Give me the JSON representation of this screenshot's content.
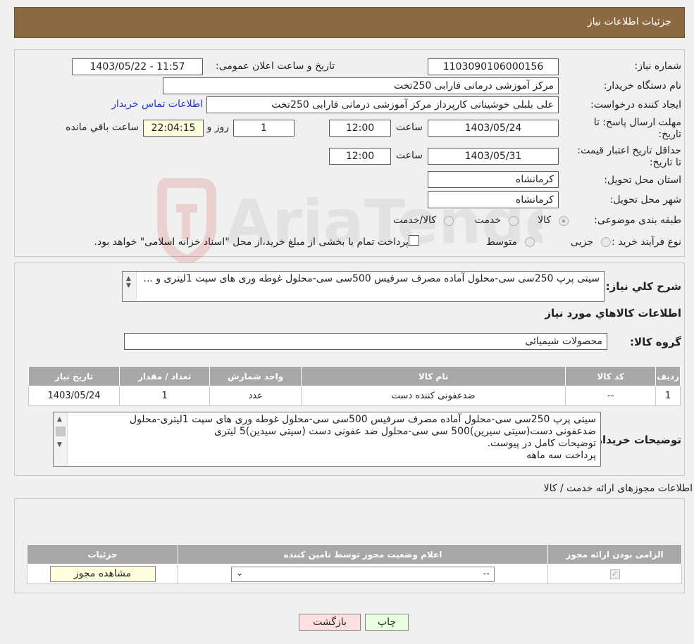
{
  "header": {
    "title": "جزئیات اطلاعات نیاز"
  },
  "form": {
    "need_number_label": "شماره نیاز:",
    "need_number": "1103090106000156",
    "announce_label": "تاریخ و ساعت اعلان عمومی:",
    "announce_value": "1403/05/22 - 11:57",
    "buyer_org_label": "نام دستگاه خریدار:",
    "buyer_org": "مرکز آموزشی  درمانی فارابی 250تخت",
    "requester_label": "ایجاد کننده درخواست:",
    "requester": "علی بلبلی خوشینانی کارپرداز مرکز آموزشی  درمانی فارابی 250تخت",
    "contact_link": "اطلاعات تماس خریدار",
    "deadline_label": "مهلت ارسال پاسخ: تا تاریخ:",
    "deadline_date": "1403/05/24",
    "time_label": "ساعت",
    "deadline_time": "12:00",
    "days_value": "1",
    "days_label": "روز و",
    "remaining_time": "22:04:15",
    "remaining_label": "ساعت باقي مانده",
    "price_validity_label": "حداقل تاريخ اعتبار قيمت: تا تاريخ:",
    "price_validity_date": "1403/05/31",
    "price_validity_time": "12:00",
    "province_label": "استان محل تحویل:",
    "province": "کرمانشاه",
    "city_label": "شهر محل تحویل:",
    "city": "کرمانشاه",
    "category_label": "طبقه بندی موضوعی:",
    "category_options": [
      "کالا",
      "خدمت",
      "کالا/خدمت"
    ],
    "process_label": "نوع فرآیند خرید :",
    "process_options": [
      "جزیی",
      "متوسط"
    ],
    "process_note": "پرداخت تمام یا بخشی از مبلغ خرید،از محل \"اسناد خزانه اسلامی\" خواهد بود."
  },
  "description": {
    "label": "شرح کلي نياز:",
    "text": "سیتی پرپ 250سی سی-محلول آماده مصرف سرفیس 500سی سی-محلول غوطه وری های سپت 1لیتری و ..."
  },
  "goods": {
    "section_title": "اطلاعات کالاهاي مورد نياز",
    "group_label": "گروه کالا:",
    "group_value": "محصولات شیمیائی",
    "columns": [
      "رديف",
      "کد کالا",
      "نام کالا",
      "واحد شمارش",
      "تعداد / مقدار",
      "تاریخ نیاز"
    ],
    "rows": [
      [
        "1",
        "--",
        "ضدعفونی کننده دست",
        "عدد",
        "1",
        "1403/05/24"
      ]
    ]
  },
  "buyer_notes": {
    "label": "توضیحات خریدار:",
    "lines": [
      "سیتی پرپ 250سی سی-محلول آماده مصرف سرفیس 500سی سی-محلول غوطه وری های سپت 1لیتری-محلول",
      "ضدعفونی دست(سیتی سیرین)500 سی سی-محلول ضد عفونی دست (سیتی سیدین)5 لیتری",
      "توضیحات کامل در پیوست.",
      "پرداخت سه ماهه"
    ]
  },
  "permits": {
    "section_title": "اطلاعات مجوزهای ارائه خدمت / کالا",
    "columns": [
      "الزامی بودن ارائه مجوز",
      "اعلام وضعیت مجوز توسط تامین کننده",
      "جزئیات"
    ],
    "select_value": "--",
    "view_button": "مشاهده مجوز"
  },
  "buttons": {
    "print": "چاپ",
    "back": "بازگشت"
  },
  "watermark": {
    "text": "AriaTender.neT"
  },
  "colors": {
    "header": "#8b6a42",
    "link": "#2233cc",
    "yellow": "#ffffe0",
    "back_button": "#ffe0e0",
    "print_button": "#e8ffe0"
  }
}
